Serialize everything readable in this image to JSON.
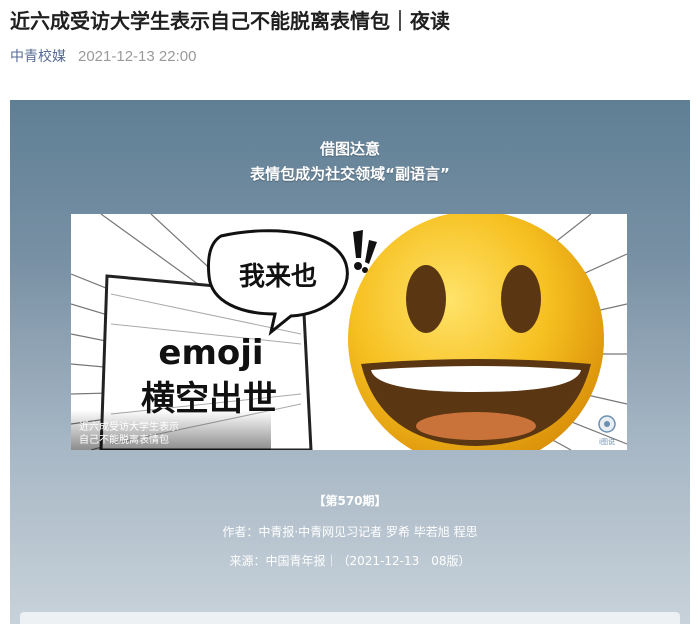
{
  "article": {
    "title": "近六成受访大学生表示自己不能脱离表情包｜夜读",
    "account": "中青校媒",
    "date": "2021-12-13 22:00"
  },
  "card": {
    "heading_line1": "借图达意",
    "heading_line2": "表情包成为社交领域“副语言”",
    "banner": {
      "speech_text": "我来也",
      "emoji_word": "emoji",
      "tagline": "横空出世",
      "caption_line1": "近六成受访大学生表示",
      "caption_line2": "自己不能脱离表情包",
      "logo_text": "i图说"
    },
    "issue": "【第570期】",
    "author": "作者：中青报·中青网见习记者 罗希 毕若旭 程思",
    "source": "来源：中国青年报｜（2021-12-13　08版）"
  },
  "colors": {
    "account_link": "#576b95",
    "date_gray": "#9a9a9a",
    "emoji_yellow": "#f6c020"
  }
}
